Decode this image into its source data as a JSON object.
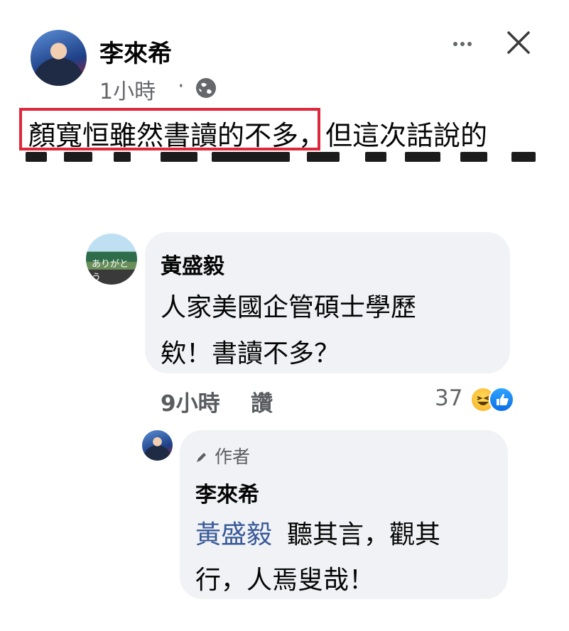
{
  "post": {
    "author": "李來希",
    "time": "1小時",
    "separator": "·",
    "text_highlight": "顏寬恒雖然書讀的不多",
    "text_rest": "，但這次話說的",
    "visibility_icon": "globe-icon",
    "highlight_color": "#e0263a"
  },
  "header_actions": {
    "more_icon": "more-dots-icon",
    "close_icon": "close-icon"
  },
  "comment": {
    "author": "黃盛毅",
    "line1": "人家美國企管碩士學歷",
    "line2": "欸！書讀不多？",
    "time": "9小時",
    "like_label": "讚",
    "reaction_count": "37",
    "reaction_icons": [
      "haha-icon",
      "like-icon"
    ]
  },
  "reply": {
    "badge": "作者",
    "author": "李來希",
    "mention": "黃盛毅",
    "line1": "聽其言，觀其",
    "line2": "行，人焉叟哉！",
    "mention_color": "#385898"
  }
}
